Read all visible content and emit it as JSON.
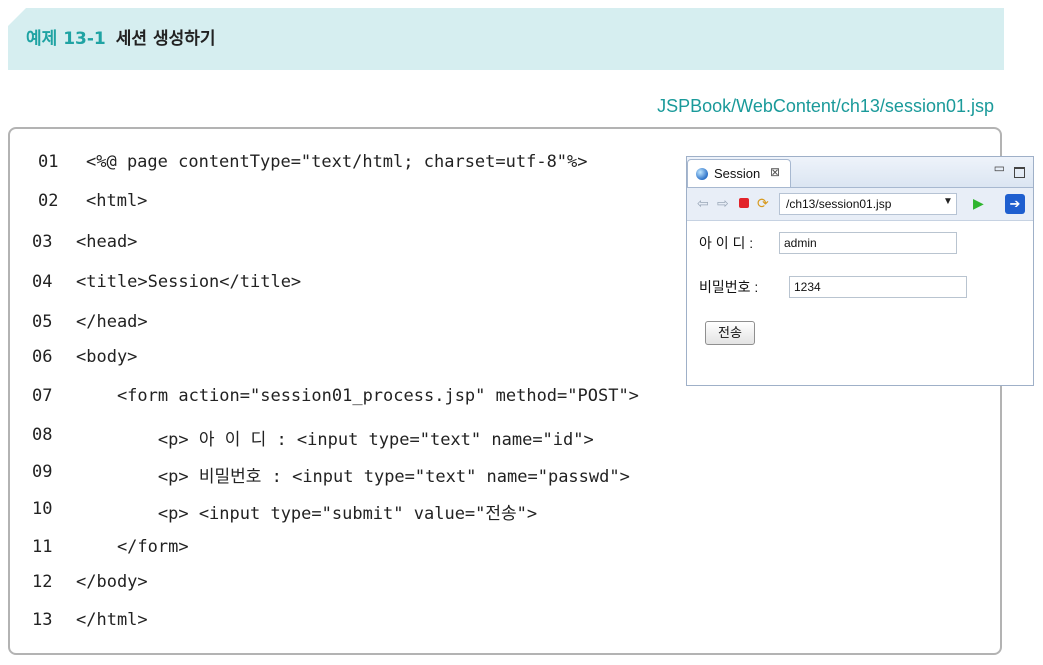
{
  "header": {
    "example_number": "예제 13-1",
    "title": "세션 생성하기"
  },
  "file_path": "JSPBook/WebContent/ch13/session01.jsp",
  "code_lines": [
    {
      "ln": "01",
      "text": "<%@ page contentType=\"text/html; charset=utf-8\"%>"
    },
    {
      "ln": "02",
      "text": "<html>"
    },
    {
      "ln": "03",
      "text": "<head>"
    },
    {
      "ln": "04",
      "text": "<title>Session</title>"
    },
    {
      "ln": "05",
      "text": "</head>"
    },
    {
      "ln": "06",
      "text": "<body>"
    },
    {
      "ln": "07",
      "text": "    <form action=\"session01_process.jsp\" method=\"POST\">"
    },
    {
      "ln": "08",
      "text": "        <p> 아 이 디 : <input type=\"text\" name=\"id\">"
    },
    {
      "ln": "09",
      "text": "        <p> 비밀번호 : <input type=\"text\" name=\"passwd\">"
    },
    {
      "ln": "10",
      "text": "        <p> <input type=\"submit\" value=\"전송\">"
    },
    {
      "ln": "11",
      "text": "    </form>"
    },
    {
      "ln": "12",
      "text": "</body>"
    },
    {
      "ln": "13",
      "text": "</html>"
    }
  ],
  "browser": {
    "tab_title": "Session",
    "tab_close": "⊠",
    "url": "/ch13/session01.jsp",
    "form": {
      "id_label": "아 이 디 :",
      "id_value": "admin",
      "passwd_label": "비밀번호 :",
      "passwd_value": "1234",
      "submit_label": "전송"
    }
  }
}
